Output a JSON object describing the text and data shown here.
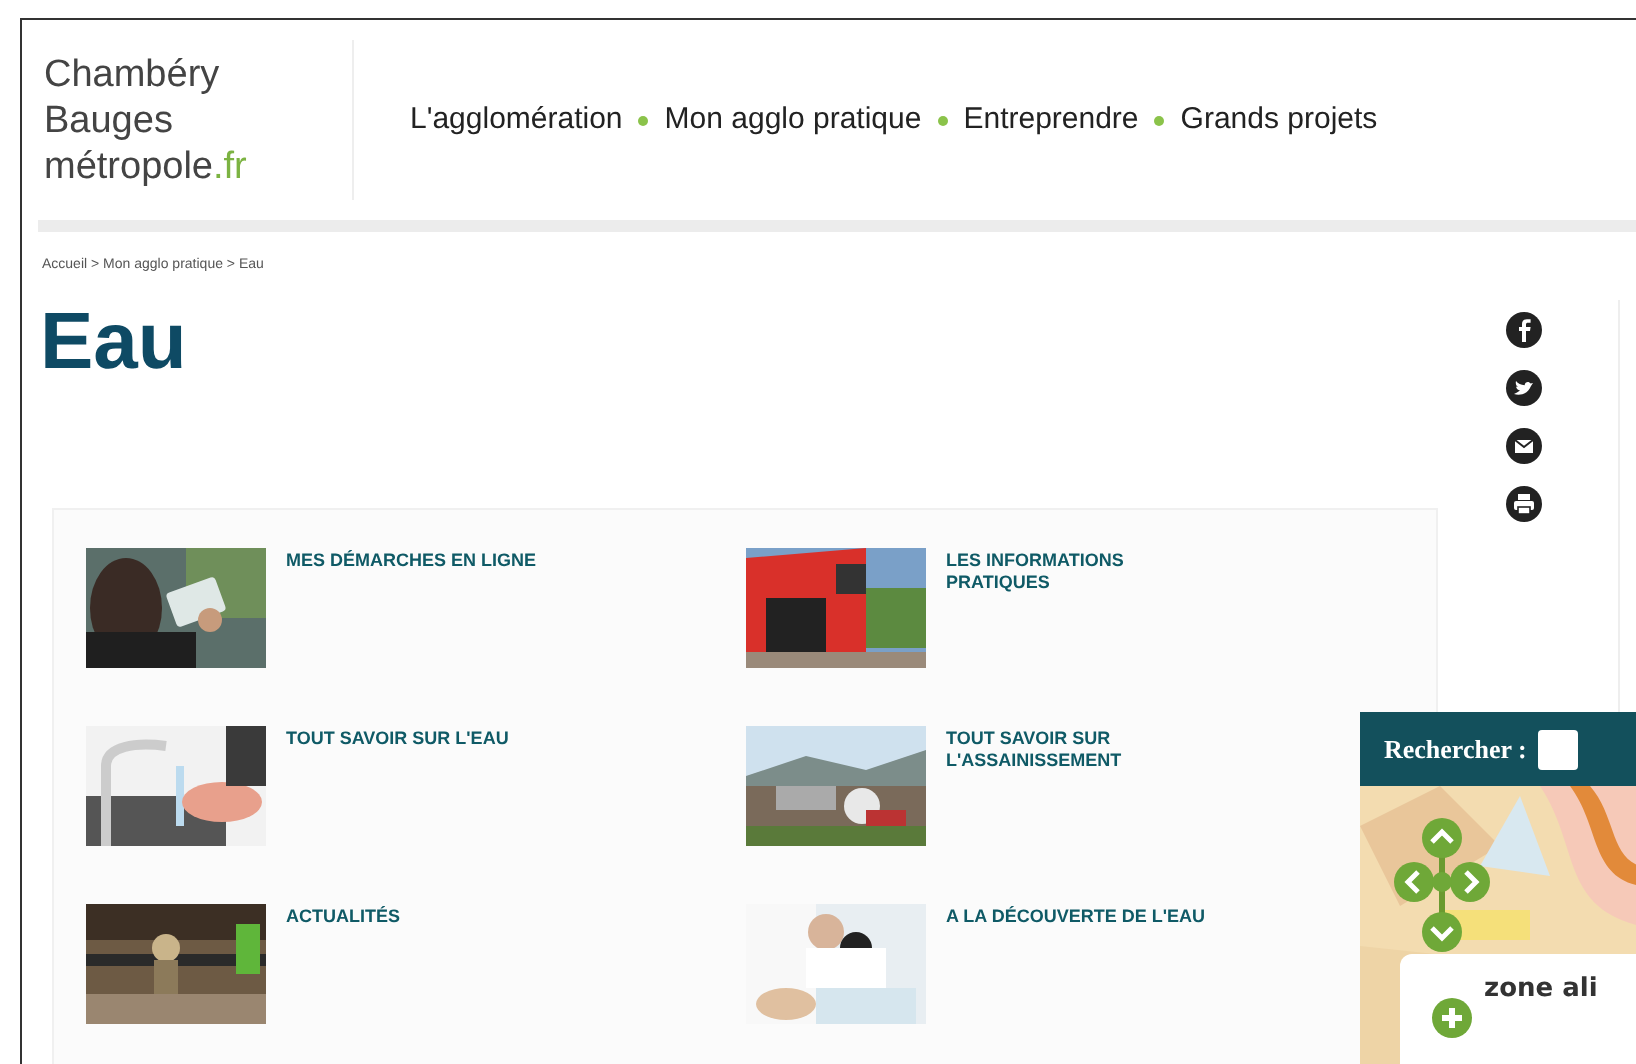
{
  "logo": {
    "lines": [
      "Chambéry",
      "Bauges",
      "métropole"
    ],
    "suffix": ".fr"
  },
  "nav": {
    "items": [
      "L'agglomération",
      "Mon agglo pratique",
      "Entreprendre",
      "Grands projets"
    ]
  },
  "breadcrumb": "Accueil > Mon agglo pratique > Eau",
  "title": "Eau",
  "share": {
    "items": [
      {
        "kind": "facebook"
      },
      {
        "kind": "twitter"
      },
      {
        "kind": "email"
      },
      {
        "kind": "print"
      }
    ]
  },
  "tiles": [
    {
      "title": "MES DÉMARCHES EN LIGNE",
      "kind": "picture"
    },
    {
      "title": "LES INFORMATIONS PRATIQUES",
      "kind": "picture"
    },
    {
      "title": "TOUT SAVOIR SUR L'EAU",
      "kind": "picture"
    },
    {
      "title": "TOUT SAVOIR SUR L'ASSAINISSEMENT",
      "kind": "picture"
    },
    {
      "title": "ACTUALITÉS",
      "kind": "picture"
    },
    {
      "title": "A LA DÉCOUVERTE DE L'EAU",
      "kind": "picture"
    }
  ],
  "map_widget": {
    "search_label": "Rechercher :",
    "popup_text": "zone ali"
  }
}
